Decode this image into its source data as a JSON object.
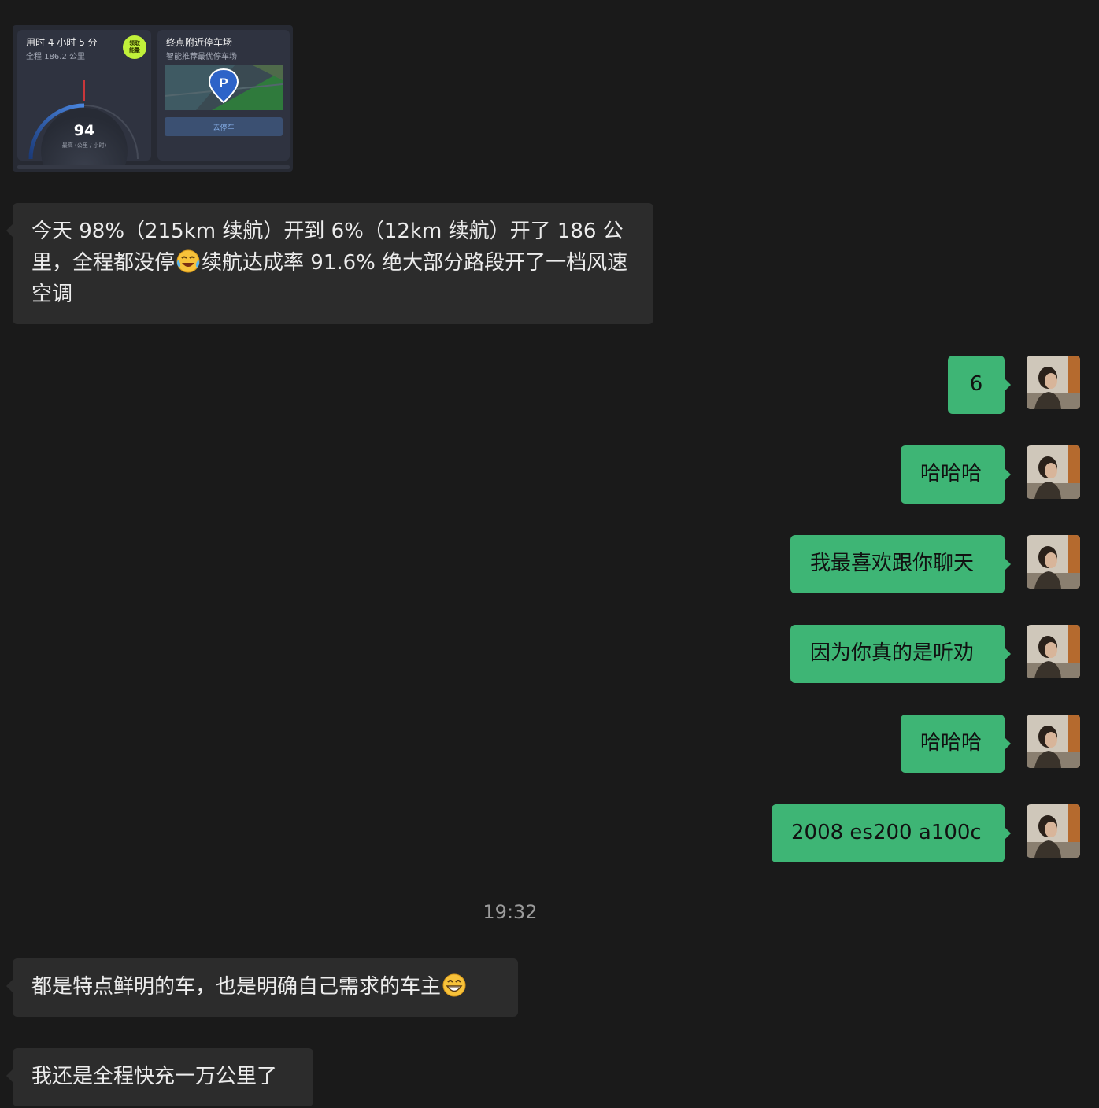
{
  "image_message": {
    "trip_card": {
      "title": "用时 4 小时 5 分",
      "subtitle": "全程 186.2 公里",
      "badge": "领取\n能量",
      "top_speed": "94",
      "speed_unit": "最高 (公里 / 小时)"
    },
    "parking_card": {
      "title": "终点附近停车场",
      "subtitle": "智能推荐最优停车场",
      "pin_letter": "P",
      "button_label": "去停车"
    }
  },
  "messages": [
    {
      "side": "left",
      "text": "今天 98%（215km 续航）开到 6%（12km 续航）开了 186 公里，全程都没停",
      "emoji": "crying-laughing-emoji",
      "text_after": "续航达成率 91.6% 绝大部分路段开了一档风速空调"
    },
    {
      "side": "right",
      "text": "6"
    },
    {
      "side": "right",
      "text": "哈哈哈"
    },
    {
      "side": "right",
      "text": "我最喜欢跟你聊天"
    },
    {
      "side": "right",
      "text": "因为你真的是听劝"
    },
    {
      "side": "right",
      "text": "哈哈哈"
    },
    {
      "side": "right",
      "text": "2008 es200 a100c"
    },
    {
      "side": "left",
      "text": "都是特点鲜明的车，也是明确自己需求的车主",
      "emoji": "grinning-emoji"
    },
    {
      "side": "left",
      "text": "我还是全程快充一万公里了"
    }
  ],
  "time_separator": "19:32",
  "colors": {
    "background": "#1a1a1a",
    "incoming_bubble": "#2c2c2c",
    "outgoing_bubble": "#3eb575",
    "badge_green": "#c1f13a"
  }
}
